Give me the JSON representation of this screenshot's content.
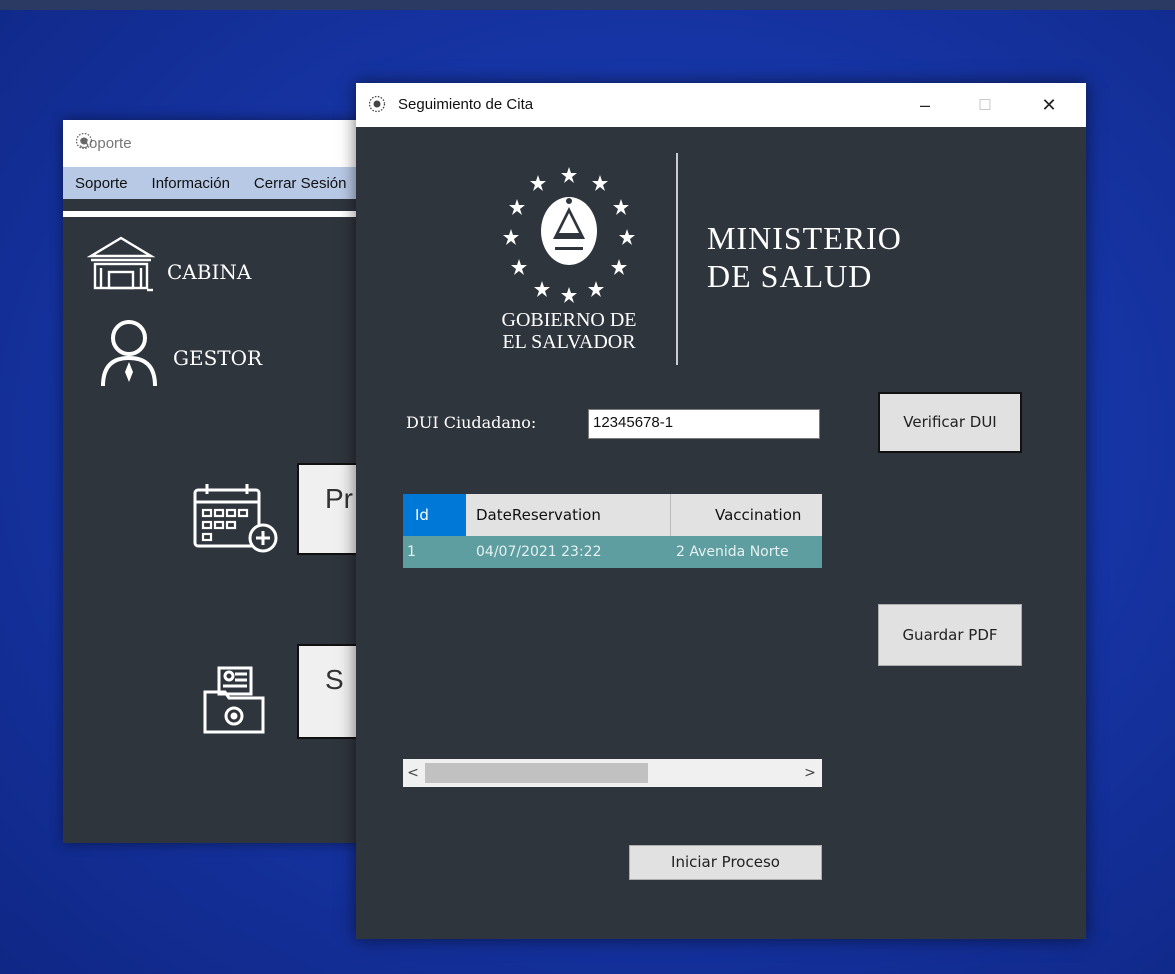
{
  "back_window": {
    "title": "Soporte",
    "menu": [
      "Soporte",
      "Información",
      "Cerrar Sesión"
    ],
    "nav": [
      {
        "label": "CABINA",
        "icon": "building-icon"
      },
      {
        "label": "GESTOR",
        "icon": "user-icon"
      }
    ],
    "buttons": [
      {
        "label": "Pr",
        "icon": "calendar-add-icon"
      },
      {
        "label": "S",
        "icon": "medical-folder-icon"
      }
    ]
  },
  "front_window": {
    "title": "Seguimiento de Cita",
    "window_controls": {
      "minimize": "–",
      "maximize": "☐",
      "close": "✕"
    },
    "brand": {
      "gov_line1": "GOBIERNO DE",
      "gov_line2": "EL SALVADOR",
      "ministry_line1": "MINISTERIO",
      "ministry_line2": "DE SALUD"
    },
    "dui": {
      "label": "DUI Ciudadano:",
      "value": "12345678-1"
    },
    "buttons": {
      "verify": "Verificar DUI",
      "save_pdf": "Guardar PDF",
      "start": "Iniciar Proceso"
    },
    "table": {
      "columns": [
        "Id",
        "DateReservation",
        "Vaccination"
      ],
      "rows": [
        [
          "1",
          "04/07/2021 23:22",
          "2 Avenida Norte"
        ]
      ]
    },
    "scrollbar": {
      "left": "<",
      "right": ">"
    }
  },
  "colors": {
    "desktop": "#1736a8",
    "window_body": "#2f353c",
    "selected_row": "#5f9ea0",
    "menubar": "#b8c9e6",
    "header_selected": "#0078d7"
  }
}
